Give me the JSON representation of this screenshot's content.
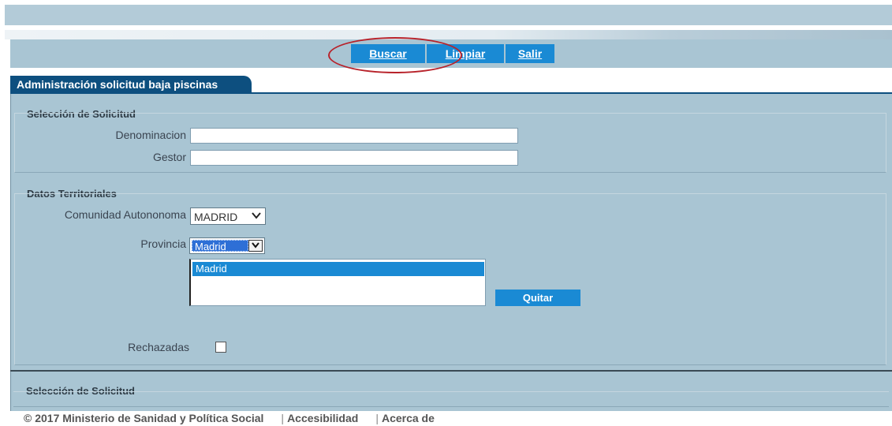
{
  "toolbar": {
    "buscar_label": "Buscar",
    "limpiar_label": "Limpiar",
    "salir_label": "Salir"
  },
  "tab": {
    "title": "Administración solicitud baja piscinas"
  },
  "seleccion": {
    "legend": "Selección de Solicitud",
    "denominacion_label": "Denominacion",
    "denominacion_value": "",
    "gestor_label": "Gestor",
    "gestor_value": ""
  },
  "territoriales": {
    "legend": "Datos Territoriales",
    "comunidad_label": "Comunidad Autononoma",
    "comunidad_value": "MADRID",
    "provincia_label": "Provincia",
    "provincia_value": "Madrid",
    "list_items": [
      "Madrid"
    ],
    "quitar_label": "Quitar",
    "rechazadas_label": "Rechazadas",
    "rechazadas_checked": false
  },
  "seleccion2": {
    "legend": "Selección de Solicitud"
  },
  "footer": {
    "copyright": "© 2017 Ministerio de Sanidad y Política Social",
    "accesibilidad": "Accesibilidad",
    "acerca": "Acerca de"
  },
  "colors": {
    "accent": "#1a8ad4",
    "tab": "#0d4f7f",
    "panel": "#a9c5d3",
    "annotation": "#b8222a"
  }
}
